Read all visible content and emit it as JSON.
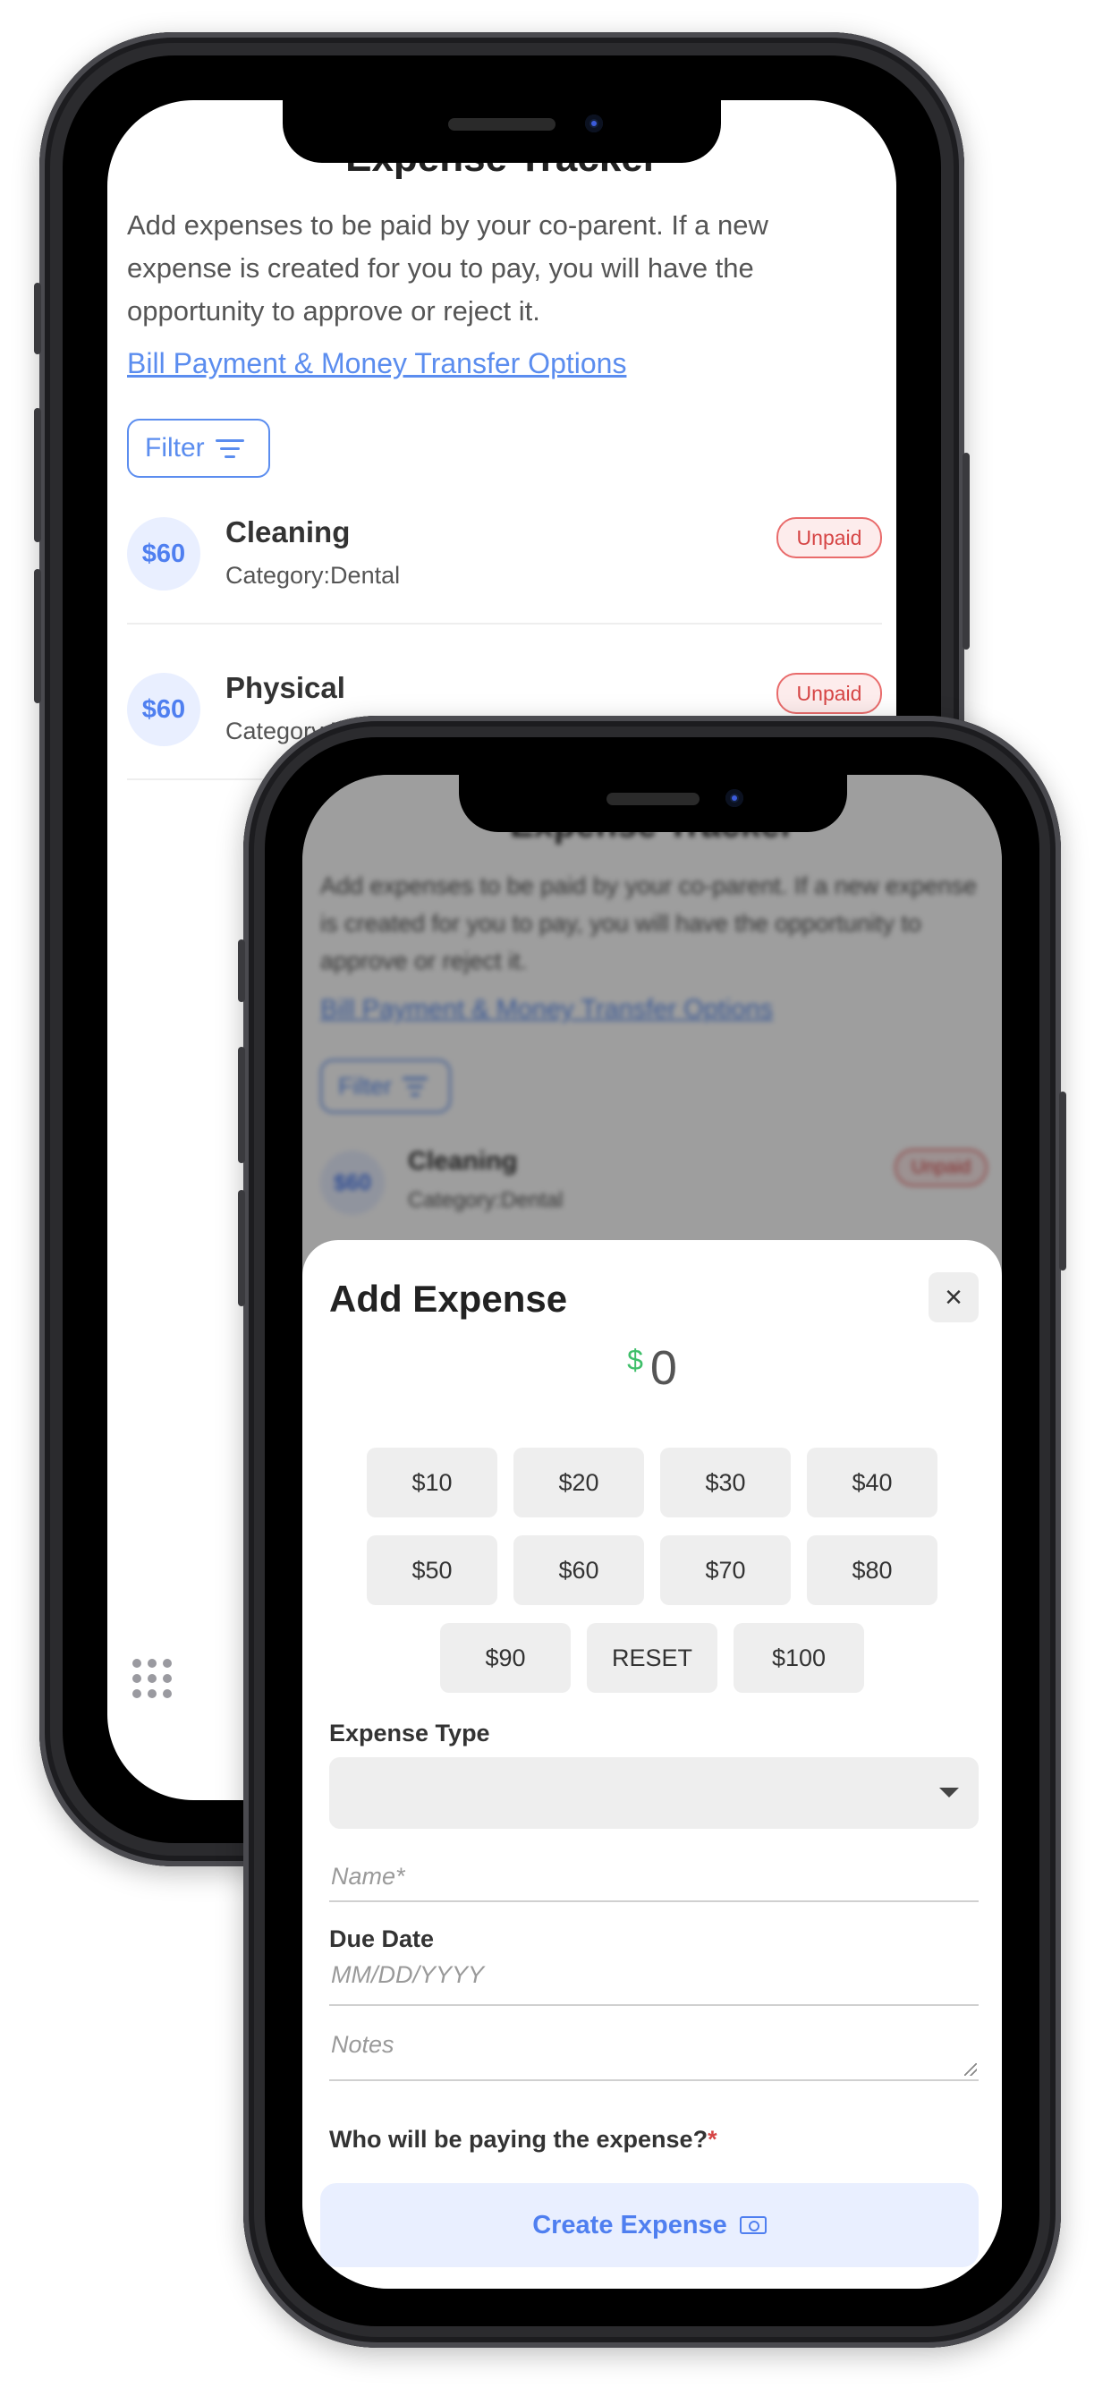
{
  "back_screen": {
    "title": "Expense Tracker",
    "description": "Add expenses to be paid by your co-parent. If a new expense is created for you to pay, you will have the opportunity to approve or reject it.",
    "bill_link": "Bill Payment & Money Transfer Options",
    "filter_label": "Filter",
    "expenses": [
      {
        "amount": "$60",
        "name": "Cleaning",
        "category": "Category:Dental",
        "status": "Unpaid"
      },
      {
        "amount": "$60",
        "name": "Physical",
        "category": "Category:Dental",
        "status": "Unpaid"
      }
    ]
  },
  "modal": {
    "title": "Add Expense",
    "close_symbol": "×",
    "currency_symbol": "$",
    "amount": "0",
    "quick_amounts_row1": [
      "$10",
      "$20",
      "$30",
      "$40"
    ],
    "quick_amounts_row2": [
      "$50",
      "$60",
      "$70",
      "$80"
    ],
    "quick_amounts_row3": [
      "$90",
      "RESET",
      "$100"
    ],
    "expense_type_label": "Expense Type",
    "name_placeholder": "Name*",
    "due_date_label": "Due Date",
    "due_date_placeholder": "MM/DD/YYYY",
    "notes_placeholder": "Notes",
    "payer_question": "Who will be paying the expense?",
    "required_mark": "*",
    "create_button": "Create Expense"
  },
  "colors": {
    "accent": "#4f7ff0",
    "currency_green": "#3fbf6a",
    "unpaid_red": "#d64545"
  }
}
